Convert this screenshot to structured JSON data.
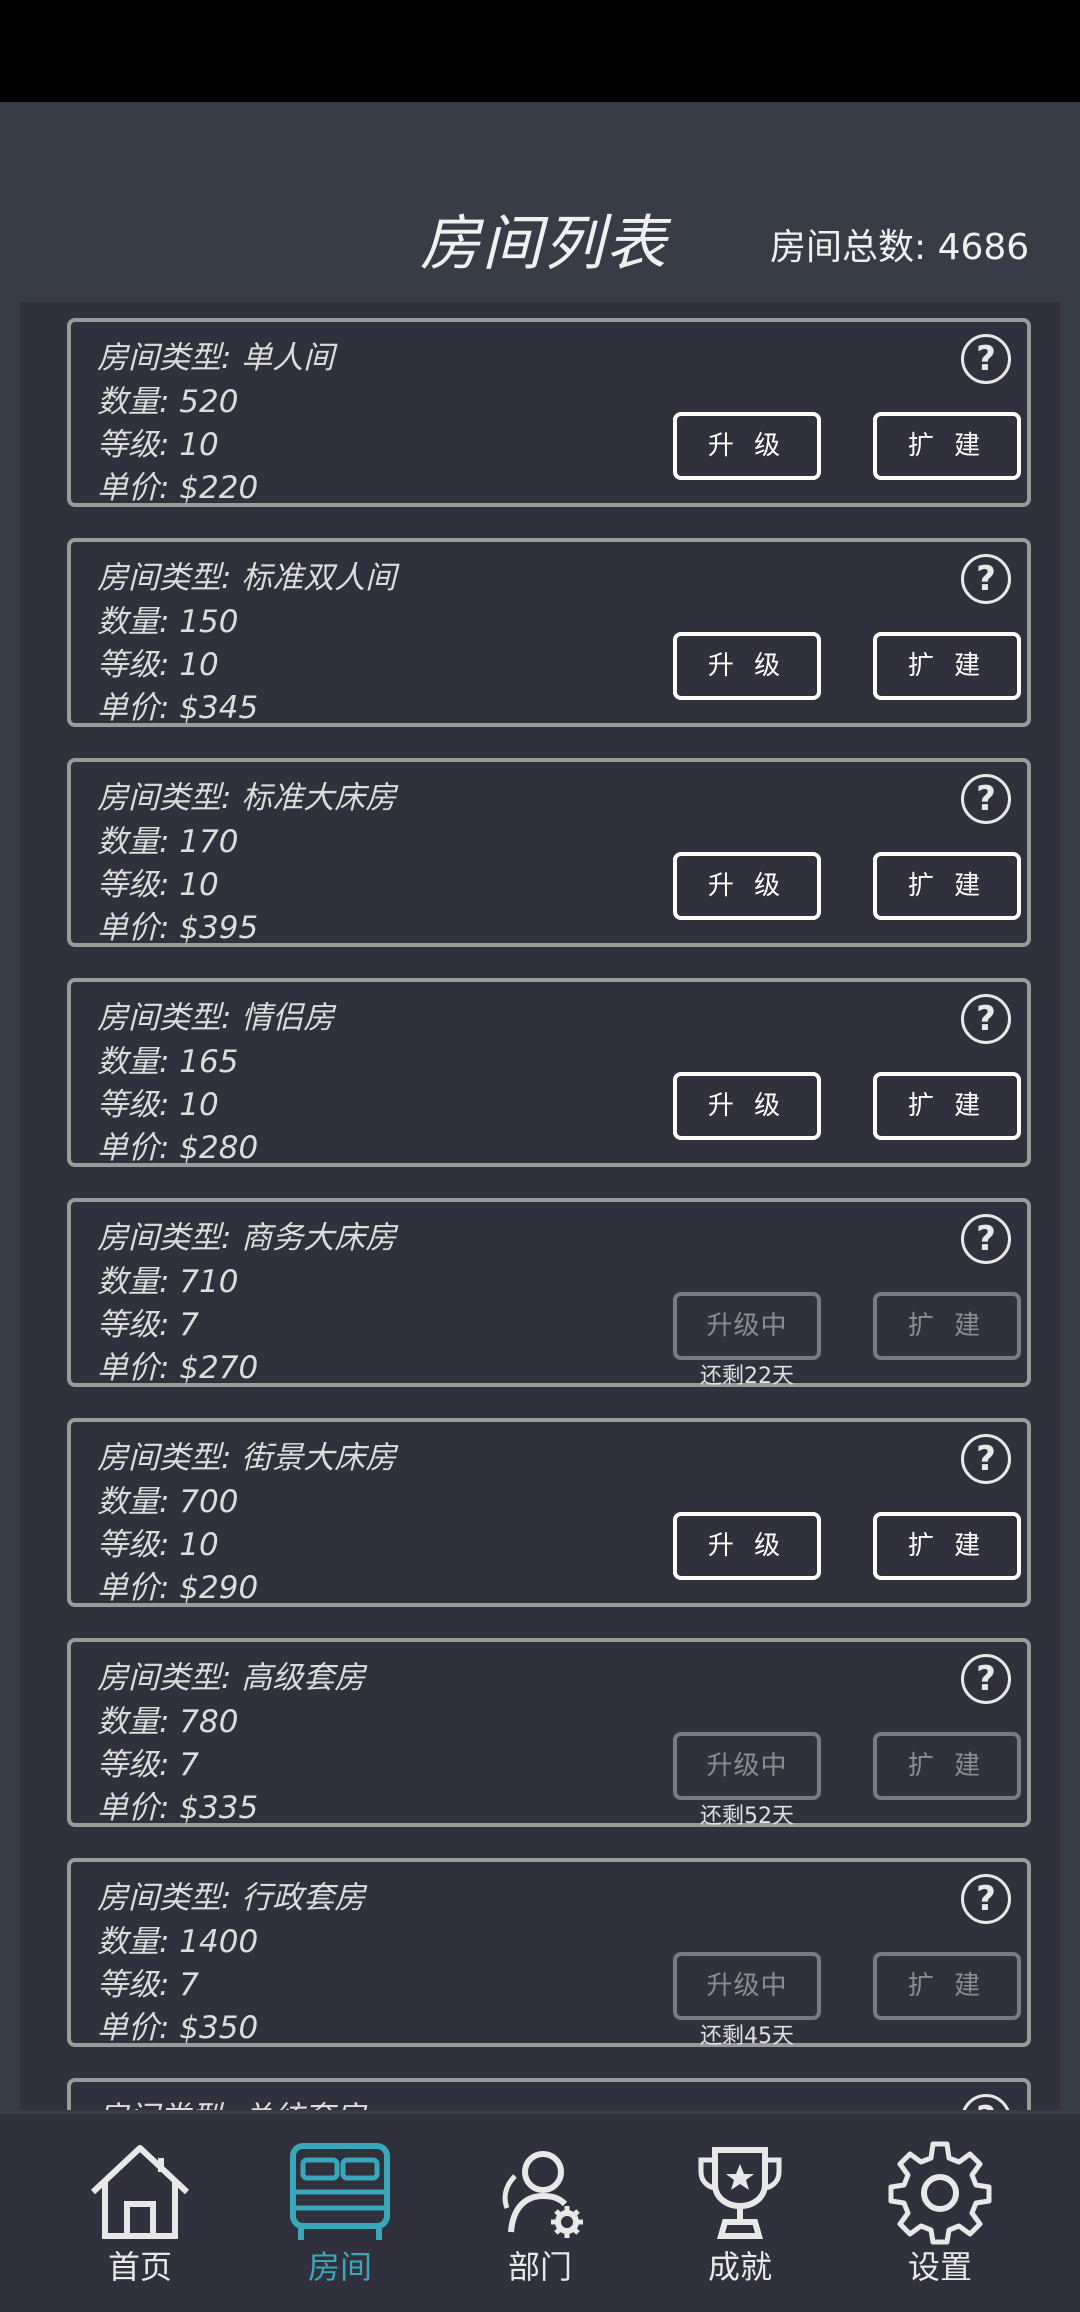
{
  "header": {
    "title": "房间列表",
    "total_label": "房间总数: 4686"
  },
  "rooms": [
    {
      "type": "房间类型: 单人间",
      "count": "数量: 520",
      "level": "等级: 10",
      "price": "单价: $220",
      "upgrade": "升 级",
      "expand": "扩 建",
      "upgrading": false,
      "remaining": ""
    },
    {
      "type": "房间类型: 标准双人间",
      "count": "数量: 150",
      "level": "等级: 10",
      "price": "单价: $345",
      "upgrade": "升 级",
      "expand": "扩 建",
      "upgrading": false,
      "remaining": ""
    },
    {
      "type": "房间类型: 标准大床房",
      "count": "数量: 170",
      "level": "等级: 10",
      "price": "单价: $395",
      "upgrade": "升 级",
      "expand": "扩 建",
      "upgrading": false,
      "remaining": ""
    },
    {
      "type": "房间类型: 情侣房",
      "count": "数量: 165",
      "level": "等级: 10",
      "price": "单价: $280",
      "upgrade": "升 级",
      "expand": "扩 建",
      "upgrading": false,
      "remaining": ""
    },
    {
      "type": "房间类型: 商务大床房",
      "count": "数量: 710",
      "level": "等级: 7",
      "price": "单价: $270",
      "upgrade": "升级中",
      "expand": "扩 建",
      "upgrading": true,
      "remaining": "还剩22天"
    },
    {
      "type": "房间类型: 街景大床房",
      "count": "数量: 700",
      "level": "等级: 10",
      "price": "单价: $290",
      "upgrade": "升 级",
      "expand": "扩 建",
      "upgrading": false,
      "remaining": ""
    },
    {
      "type": "房间类型: 高级套房",
      "count": "数量: 780",
      "level": "等级: 7",
      "price": "单价: $335",
      "upgrade": "升级中",
      "expand": "扩 建",
      "upgrading": true,
      "remaining": "还剩52天"
    },
    {
      "type": "房间类型: 行政套房",
      "count": "数量: 1400",
      "level": "等级: 7",
      "price": "单价: $350",
      "upgrade": "升级中",
      "expand": "扩 建",
      "upgrading": true,
      "remaining": "还剩45天"
    },
    {
      "type": "房间类型: 总统套房",
      "count": "",
      "level": "",
      "price": "",
      "upgrade": "",
      "expand": "",
      "upgrading": false,
      "remaining": ""
    }
  ],
  "help_symbol": "?",
  "nav": {
    "items": [
      {
        "label": "首页",
        "icon": "home-icon"
      },
      {
        "label": "房间",
        "icon": "bed-icon"
      },
      {
        "label": "部门",
        "icon": "staff-gear-icon"
      },
      {
        "label": "成就",
        "icon": "trophy-icon"
      },
      {
        "label": "设置",
        "icon": "gear-icon"
      }
    ],
    "active_color": "#3aa6b9"
  }
}
